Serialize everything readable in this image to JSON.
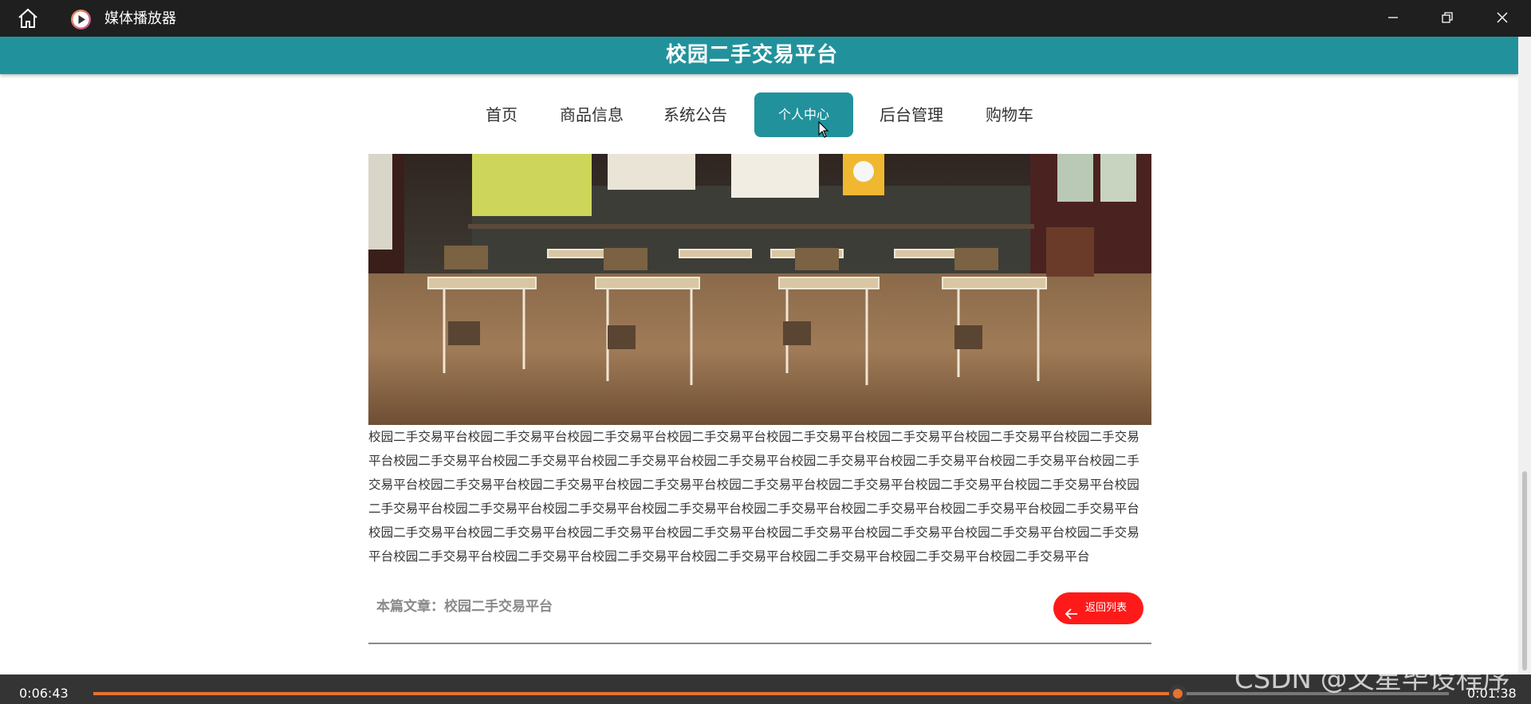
{
  "window": {
    "app_title": "媒体播放器",
    "home_icon": "home-icon",
    "app_icon": "play-circle-icon",
    "minimize_icon": "minimize-icon",
    "restore_icon": "restore-icon",
    "close_icon": "close-icon"
  },
  "site": {
    "title": "校园二手交易平台",
    "header_color": "#21929c"
  },
  "nav": {
    "items": [
      {
        "label": "首页"
      },
      {
        "label": "商品信息"
      },
      {
        "label": "系统公告"
      },
      {
        "label": "个人中心",
        "active": true
      },
      {
        "label": "后台管理"
      },
      {
        "label": "购物车"
      }
    ]
  },
  "article": {
    "image_alt": "classroom desks photo",
    "body": "校园二手交易平台校园二手交易平台校园二手交易平台校园二手交易平台校园二手交易平台校园二手交易平台校园二手交易平台校园二手交易平台校园二手交易平台校园二手交易平台校园二手交易平台校园二手交易平台校园二手交易平台校园二手交易平台校园二手交易平台校园二手交易平台校园二手交易平台校园二手交易平台校园二手交易平台校园二手交易平台校园二手交易平台校园二手交易平台校园二手交易平台校园二手交易平台校园二手交易平台校园二手交易平台校园二手交易平台校园二手交易平台校园二手交易平台校园二手交易平台校园二手交易平台校园二手交易平台校园二手交易平台校园二手交易平台校园二手交易平台校园二手交易平台校园二手交易平台校园二手交易平台校园二手交易平台校园二手交易平台校园二手交易平台校园二手交易平台校园二手交易平台校园二手交易平台校园二手交易平台校园二手交易平台",
    "this_article_label": "本篇文章：校园二手交易平台",
    "back_button_label": "返回列表",
    "back_button_color": "#ff1a1a"
  },
  "player": {
    "current_time": "0:06:43",
    "remaining_time": "0:01:38",
    "progress_fraction": 0.8,
    "progress_color": "#e8712e"
  },
  "watermark": {
    "text": "CSDN @文星毕设程序"
  }
}
